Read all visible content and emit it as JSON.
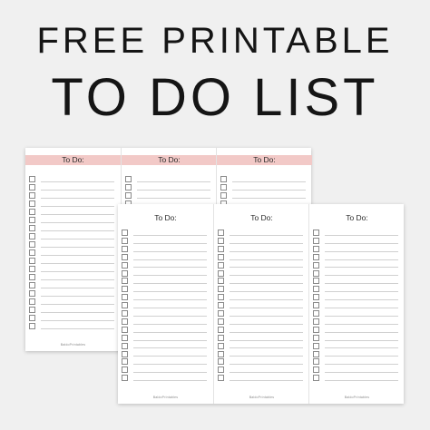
{
  "title": {
    "line1": "FREE PRINTABLE",
    "line2": "TO DO LIST"
  },
  "back_sheet": {
    "accent_color": "#f2c9c7",
    "columns": [
      {
        "header": "To Do:",
        "footer": "BaldoPrintables"
      },
      {
        "header": "To Do:",
        "footer": ""
      },
      {
        "header": "To Do:",
        "footer": ""
      }
    ]
  },
  "front_sheet": {
    "columns": [
      {
        "header": "To Do:",
        "footer": "BaldoPrintables"
      },
      {
        "header": "To Do:",
        "footer": "BaldoPrintables"
      },
      {
        "header": "To Do:",
        "footer": "BaldoPrintables"
      }
    ]
  },
  "icons": {
    "checkbox": "checkbox-icon"
  }
}
